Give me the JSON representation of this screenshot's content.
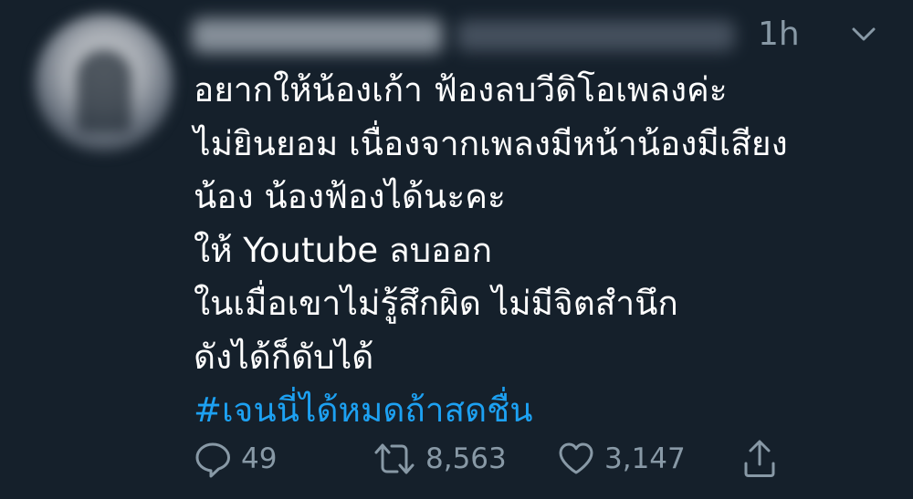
{
  "tweet": {
    "timestamp": "1h",
    "body_lines": [
      "อยากให้น้องเก้า ฟ้องลบวีดิโอเพลงค่ะ",
      "ไม่ยินยอม เนื่องจากเพลงมีหน้าน้องมีเสียง",
      "น้อง  น้องฟ้องได้นะคะ",
      "ให้ Youtube ลบออก",
      "ในเมื่อเขาไม่รู้สึกผิด ไม่มีจิตสำนึก",
      "ดังได้ก็ดับได้"
    ],
    "hashtag": "#เจนนี่ได้หมดถ้าสดชื่น"
  },
  "actions": {
    "reply_count": "49",
    "retweet_count": "8,563",
    "like_count": "3,147"
  },
  "icons": {
    "reply": "reply-icon",
    "retweet": "retweet-icon",
    "like": "heart-icon",
    "share": "share-icon",
    "menu": "chevron-down-icon"
  },
  "colors": {
    "background": "#15202b",
    "text": "#ffffff",
    "muted": "#8899a6",
    "hashtag": "#1da1f2"
  }
}
